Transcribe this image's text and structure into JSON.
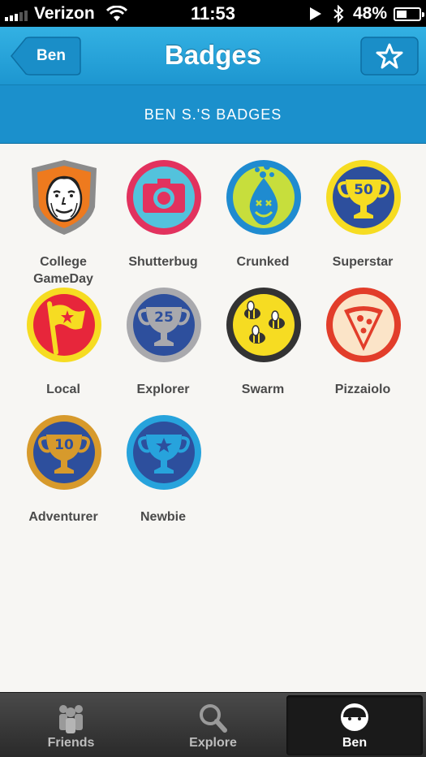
{
  "status_bar": {
    "carrier": "Verizon",
    "time": "11:53",
    "battery": "48%",
    "battery_level": 0.48
  },
  "nav": {
    "back_label": "Ben",
    "title": "Badges",
    "action_icon": "star-icon"
  },
  "section": {
    "header": "BEN S.'S BADGES"
  },
  "badges": [
    {
      "label": "College\nGameDay",
      "icon": "college-gameday-icon"
    },
    {
      "label": "Shutterbug",
      "icon": "camera-icon"
    },
    {
      "label": "Crunked",
      "icon": "crunked-icon"
    },
    {
      "label": "Superstar",
      "icon": "trophy-50-icon"
    },
    {
      "label": "Local",
      "icon": "flag-icon"
    },
    {
      "label": "Explorer",
      "icon": "trophy-25-icon"
    },
    {
      "label": "Swarm",
      "icon": "bees-icon"
    },
    {
      "label": "Pizzaiolo",
      "icon": "pizza-icon"
    },
    {
      "label": "Adventurer",
      "icon": "trophy-10-icon"
    },
    {
      "label": "Newbie",
      "icon": "trophy-star-icon"
    }
  ],
  "tabs": [
    {
      "label": "Friends",
      "icon": "friends-icon"
    },
    {
      "label": "Explore",
      "icon": "search-icon"
    },
    {
      "label": "Ben",
      "icon": "avatar-icon",
      "active": true
    }
  ],
  "colors": {
    "nav_blue": "#1d96d0",
    "section_blue": "#1b90cc",
    "background": "#f7f6f3",
    "label_text": "#4a4a4a"
  }
}
